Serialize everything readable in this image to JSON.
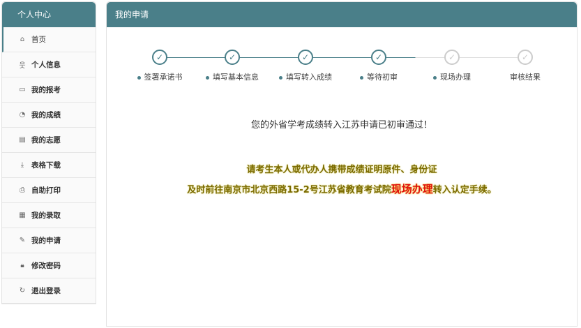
{
  "sidebar": {
    "title": "个人中心",
    "items": [
      {
        "label": "首页",
        "icon": "home-icon",
        "glyph": "⌂"
      },
      {
        "label": "个人信息",
        "icon": "user-icon",
        "glyph": "웃"
      },
      {
        "label": "我的报考",
        "icon": "id-card-icon",
        "glyph": "▭"
      },
      {
        "label": "我的成绩",
        "icon": "pie-chart-icon",
        "glyph": "◔"
      },
      {
        "label": "我的志愿",
        "icon": "document-icon",
        "glyph": "▤"
      },
      {
        "label": "表格下载",
        "icon": "download-icon",
        "glyph": "⤓"
      },
      {
        "label": "自助打印",
        "icon": "printer-icon",
        "glyph": "⎙"
      },
      {
        "label": "我的录取",
        "icon": "calendar-icon",
        "glyph": "▦"
      },
      {
        "label": "我的申请",
        "icon": "edit-icon",
        "glyph": "✎"
      },
      {
        "label": "修改密码",
        "icon": "lock-icon",
        "glyph": "🔒︎"
      },
      {
        "label": "退出登录",
        "icon": "logout-icon",
        "glyph": "↻"
      }
    ]
  },
  "main": {
    "title": "我的申请",
    "steps": [
      {
        "label": "签署承诺书",
        "done": true
      },
      {
        "label": "填写基本信息",
        "done": true
      },
      {
        "label": "填写转入成绩",
        "done": true
      },
      {
        "label": "等待初审",
        "done": true
      },
      {
        "label": "现场办理",
        "done": false
      },
      {
        "label": "审核结果",
        "done": false
      }
    ],
    "message": "您的外省学考成绩转入江苏申请已初审通过！",
    "note_line1": "请考生本人或代办人携带成绩证明原件、身份证",
    "note_line2_pre": "及时前往南京市北京西路15-2号江苏省教育考试院",
    "note_line2_highlight": "现场办理",
    "note_line2_post": "转入认定手续。"
  },
  "colors": {
    "accent": "#4a7f89",
    "note": "#7a6a00",
    "highlight": "#e01010"
  }
}
